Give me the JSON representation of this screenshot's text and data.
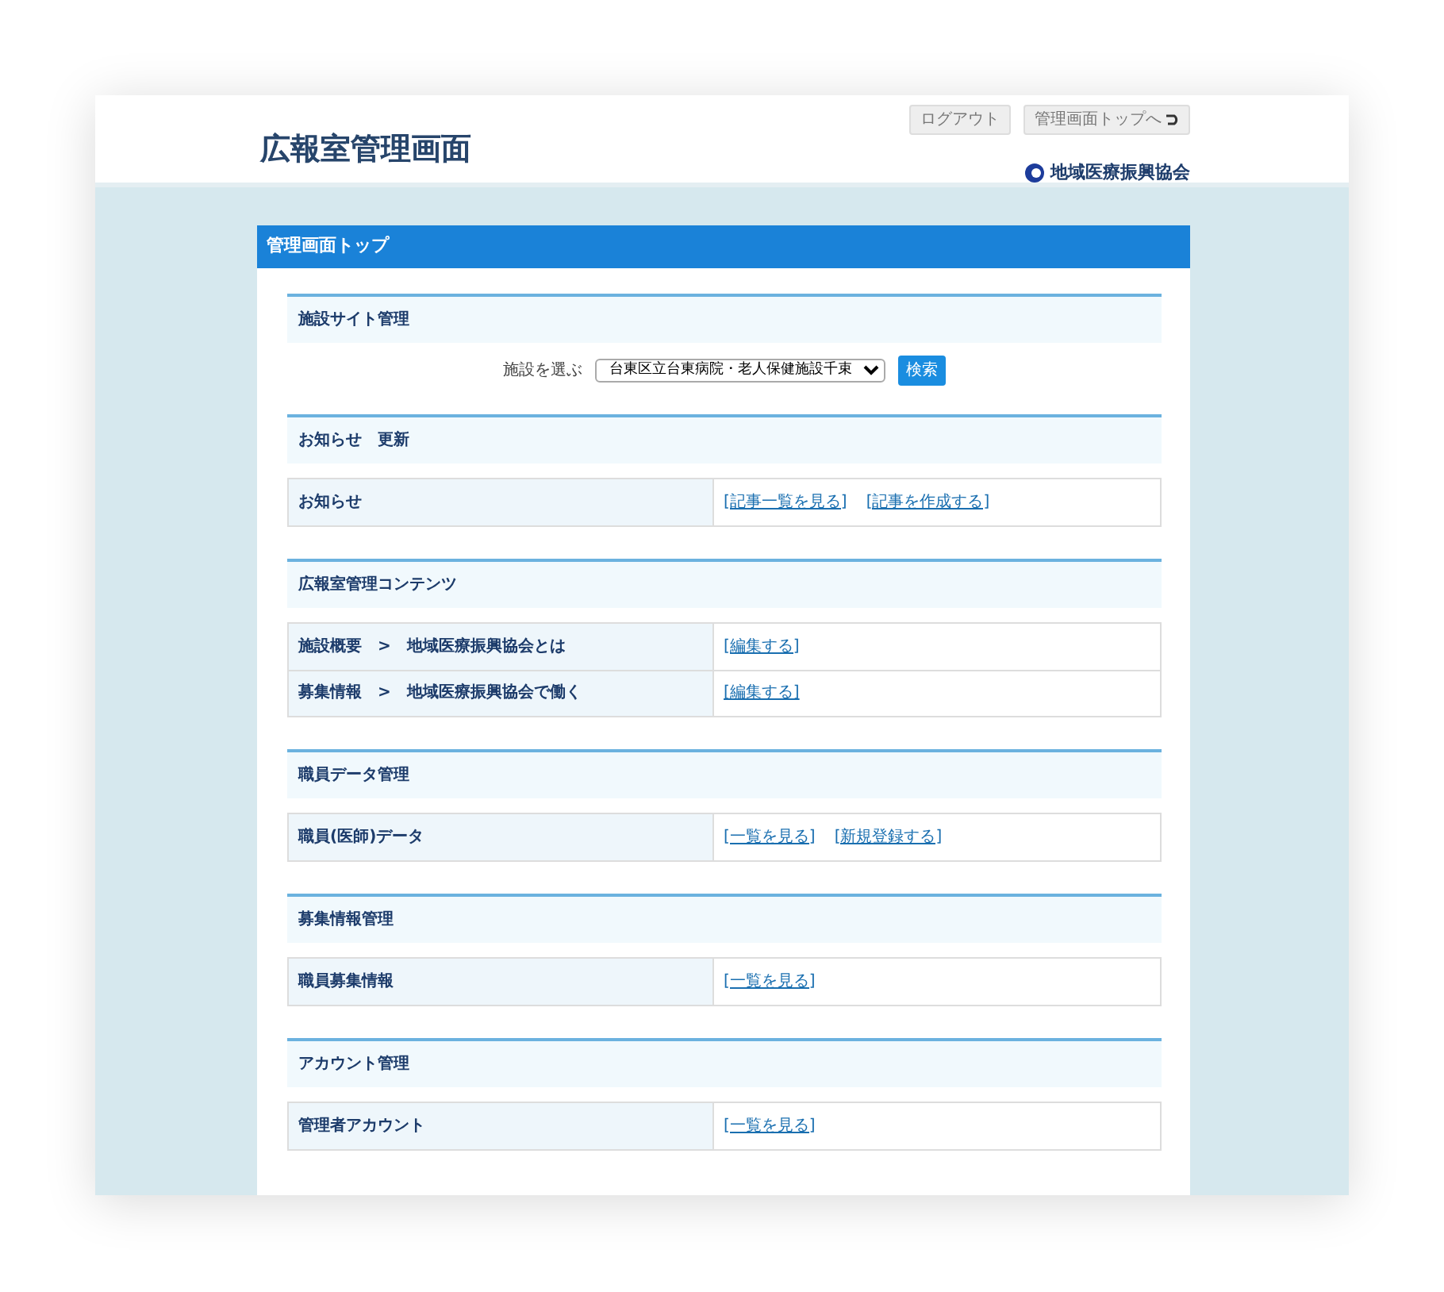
{
  "header": {
    "title": "広報室管理画面",
    "buttons": [
      "ログアウト",
      "管理画面トップへ"
    ],
    "organization": "地域医療振興協会"
  },
  "panel": {
    "title": "管理画面トップ"
  },
  "sections": [
    {
      "kind": "select",
      "title": "施設サイト管理",
      "label": "施設を選ぶ",
      "value": "台東区立台東病院・老人保健施設千束",
      "button": "検索"
    },
    {
      "kind": "table",
      "title": "お知らせ　更新",
      "rows": [
        {
          "label": "お知らせ",
          "links": [
            "[記事一覧を見る]",
            "[記事を作成する]"
          ]
        }
      ]
    },
    {
      "kind": "table",
      "title": "広報室管理コンテンツ",
      "rows": [
        {
          "label": "施設概要　>　地域医療振興協会とは",
          "links": [
            "[編集する]"
          ]
        },
        {
          "label": "募集情報　>　地域医療振興協会で働く",
          "links": [
            "[編集する]"
          ]
        }
      ]
    },
    {
      "kind": "table",
      "title": "職員データ管理",
      "rows": [
        {
          "label": "職員(医師)データ",
          "links": [
            "[一覧を見る]",
            "[新規登録する]"
          ]
        }
      ]
    },
    {
      "kind": "table",
      "title": "募集情報管理",
      "rows": [
        {
          "label": "職員募集情報",
          "links": [
            "[一覧を見る]"
          ]
        }
      ]
    },
    {
      "kind": "table",
      "title": "アカウント管理",
      "rows": [
        {
          "label": "管理者アカウント",
          "links": [
            "[一覧を見る]"
          ]
        }
      ]
    }
  ]
}
